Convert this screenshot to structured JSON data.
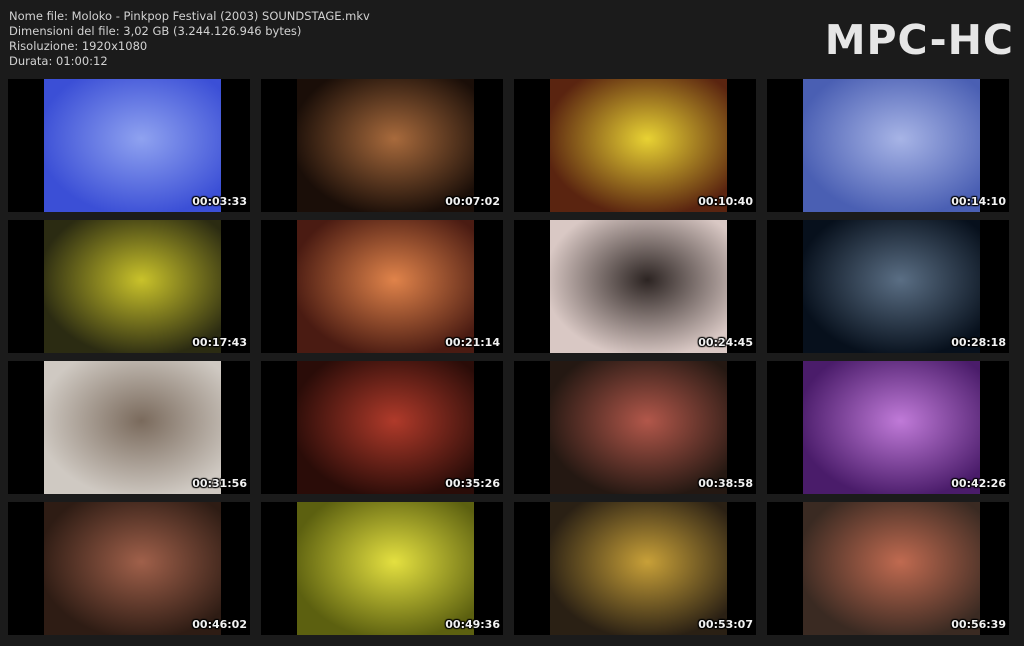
{
  "info": {
    "filename": "Nome file: Moloko - Pinkpop Festival (2003) SOUNDSTAGE.mkv",
    "filesize": "Dimensioni del file: 3,02 GB (3.244.126.946 bytes)",
    "resolution": "Risoluzione: 1920x1080",
    "duration": "Durata: 01:00:12"
  },
  "logo": "MPC-HC",
  "thumbnails": [
    {
      "time": "00:03:33",
      "colors": [
        "#3b4fd6",
        "#8fa2f0"
      ]
    },
    {
      "time": "00:07:02",
      "colors": [
        "#1a0e08",
        "#a86a3c"
      ]
    },
    {
      "time": "00:10:40",
      "colors": [
        "#5a2410",
        "#e8d233"
      ]
    },
    {
      "time": "00:14:10",
      "colors": [
        "#4a5fb3",
        "#a7b4e6"
      ]
    },
    {
      "time": "00:17:43",
      "colors": [
        "#2b2b12",
        "#c9c22a"
      ]
    },
    {
      "time": "00:21:14",
      "colors": [
        "#4a1b12",
        "#e0834a"
      ]
    },
    {
      "time": "00:24:45",
      "colors": [
        "#d9c8c4",
        "#2c2422"
      ]
    },
    {
      "time": "00:28:18",
      "colors": [
        "#07101c",
        "#5a6e84"
      ]
    },
    {
      "time": "00:31:56",
      "colors": [
        "#cfc9c2",
        "#7a6a5c"
      ]
    },
    {
      "time": "00:35:26",
      "colors": [
        "#2a0c08",
        "#b03a2a"
      ]
    },
    {
      "time": "00:38:58",
      "colors": [
        "#241812",
        "#b2574a"
      ]
    },
    {
      "time": "00:42:26",
      "colors": [
        "#4a1c6a",
        "#c07ad8"
      ]
    },
    {
      "time": "00:46:02",
      "colors": [
        "#2e1c14",
        "#a0604a"
      ]
    },
    {
      "time": "00:49:36",
      "colors": [
        "#5c6010",
        "#e4e040"
      ]
    },
    {
      "time": "00:53:07",
      "colors": [
        "#2a2014",
        "#c8a038"
      ]
    },
    {
      "time": "00:56:39",
      "colors": [
        "#3a2a22",
        "#c06a50"
      ]
    }
  ]
}
